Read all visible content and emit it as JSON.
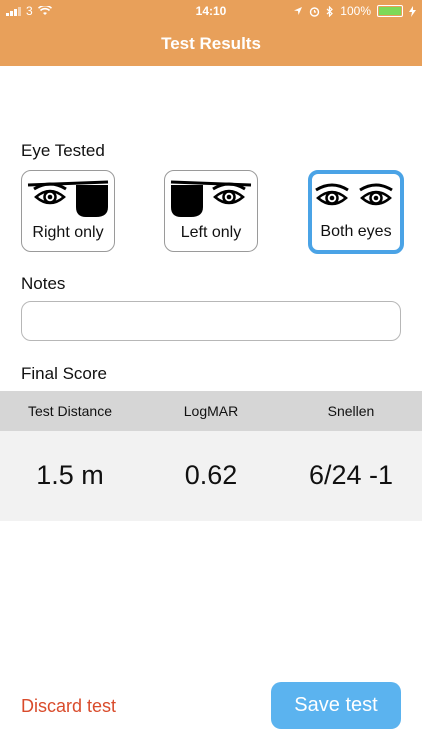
{
  "status_bar": {
    "carrier": "3",
    "time": "14:10",
    "battery": "100%"
  },
  "header": {
    "title": "Test Results"
  },
  "eye_tested": {
    "label": "Eye Tested",
    "options": [
      {
        "label": "Right only",
        "icon": "left-eye-patched-icon",
        "selected": false
      },
      {
        "label": "Left only",
        "icon": "right-eye-patched-icon",
        "selected": false
      },
      {
        "label": "Both eyes",
        "icon": "both-eyes-icon",
        "selected": true
      }
    ],
    "selected_color": "#4aa3e6"
  },
  "notes": {
    "label": "Notes",
    "value": "",
    "placeholder": ""
  },
  "final_score": {
    "label": "Final Score",
    "columns": [
      "Test Distance",
      "LogMAR",
      "Snellen"
    ],
    "values": [
      "1.5 m",
      "0.62",
      "6/24 -1"
    ]
  },
  "actions": {
    "discard_label": "Discard test",
    "save_label": "Save test",
    "discard_color": "#d94b2b",
    "save_color": "#5bb3ef"
  },
  "colors": {
    "header": "#e8a05a"
  }
}
